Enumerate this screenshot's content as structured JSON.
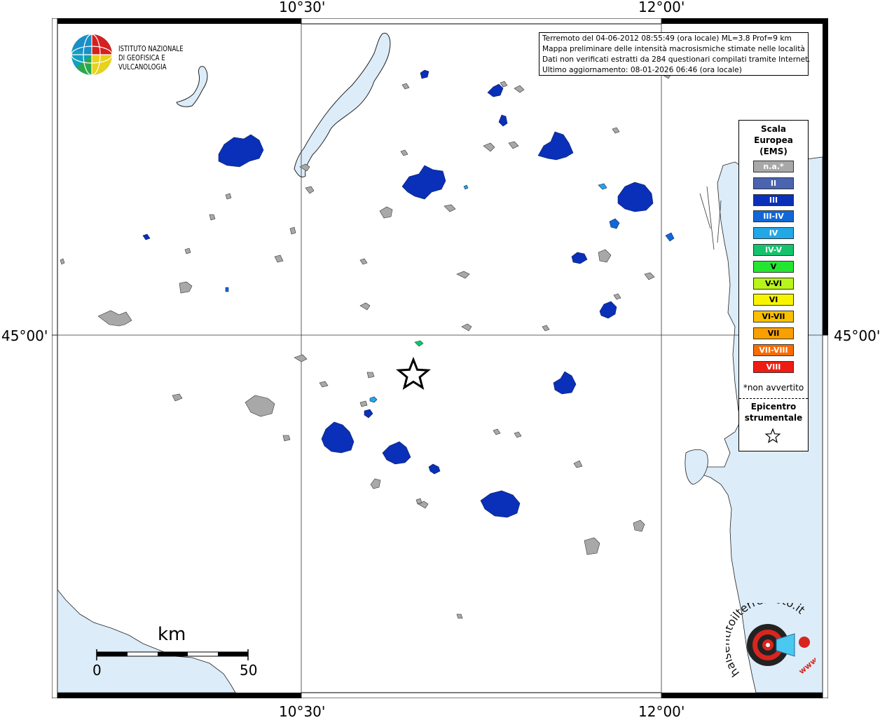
{
  "map": {
    "lon_labels_top": [
      "10°30'",
      "12°00'"
    ],
    "lon_labels_bottom": [
      "10°30'",
      "12°00'"
    ],
    "lat_labels_left": [
      "45°00'"
    ],
    "lat_labels_right": [
      "45°00'"
    ],
    "colors": {
      "water": "#dcecf8",
      "na": "#a8a8a8",
      "II": "#4a64b0",
      "III": "#0a2fb8",
      "III-IV": "#1068d8",
      "IV": "#22a8e6",
      "IV-V": "#14c36c",
      "V": "#24e632",
      "V-VI": "#b8f51a",
      "VI": "#f8f400",
      "VI-VII": "#f8c000",
      "VII": "#f8a000",
      "VII-VIII": "#f86c00",
      "VIII": "#ee1c12"
    }
  },
  "logo": {
    "line1": "ISTITUTO NAZIONALE",
    "line2": "DI GEOFISICA E VULCANOLOGIA"
  },
  "info": {
    "line1": "Terremoto del 04-06-2012 08:55:49 (ora locale) ML=3.8 Prof=9 km",
    "line2": "Mappa preliminare delle intensità macrosismiche stimate nelle località",
    "line3": "Dati non verificati estratti da 284 questionari compilati tramite Internet.",
    "line4": "Ultimo aggiornamento: 08-01-2026 06:46 (ora locale)"
  },
  "legend": {
    "title_line1": "Scala",
    "title_line2": "Europea",
    "title_line3": "(EMS)",
    "items": [
      {
        "label": "n.a.*",
        "color": "#a8a8a8"
      },
      {
        "label": "II",
        "color": "#4a64b0"
      },
      {
        "label": "III",
        "color": "#0a2fb8"
      },
      {
        "label": "III-IV",
        "color": "#1068d8"
      },
      {
        "label": "IV",
        "color": "#22a8e6"
      },
      {
        "label": "IV-V",
        "color": "#14c36c"
      },
      {
        "label": "V",
        "color": "#24e632"
      },
      {
        "label": "V-VI",
        "color": "#b8f51a"
      },
      {
        "label": "VI",
        "color": "#f8f400"
      },
      {
        "label": "VI-VII",
        "color": "#f8c000"
      },
      {
        "label": "VII",
        "color": "#f8a000"
      },
      {
        "label": "VII-VIII",
        "color": "#f86c00"
      },
      {
        "label": "VIII",
        "color": "#ee1c12"
      }
    ],
    "na_note": "*non avvertito",
    "epicentre_line1": "Epicentro",
    "epicentre_line2": "strumentale"
  },
  "scale": {
    "unit": "km",
    "min": "0",
    "max": "50"
  },
  "watermark": {
    "text": "haisentitoilterremoto.it",
    "url": "www."
  }
}
